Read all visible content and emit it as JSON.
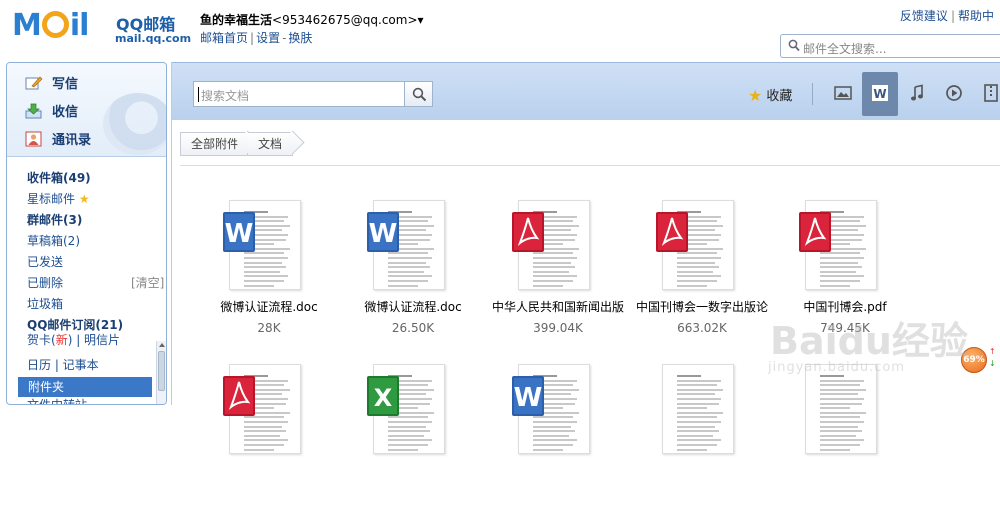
{
  "header": {
    "logo_main": "M",
    "logo_tail": "il",
    "logo_cn": "QQ邮箱",
    "logo_url": "mail.qq.com",
    "user_name": "鱼的幸福生活",
    "user_email": "<953462675@qq.com>",
    "links": [
      "邮箱首页",
      "设置",
      "换肤"
    ],
    "top_links": [
      "反馈建议",
      "帮助中"
    ],
    "fulltext_search_placeholder": "邮件全文搜索..."
  },
  "nav": {
    "quick": [
      {
        "label": "写信",
        "icon": "write-icon"
      },
      {
        "label": "收信",
        "icon": "receive-icon"
      },
      {
        "label": "通讯录",
        "icon": "contacts-icon"
      }
    ],
    "folders": [
      {
        "label": "收件箱(49)",
        "bold": true
      },
      {
        "label": "星标邮件",
        "star": true
      },
      {
        "label": "群邮件(3)",
        "bold": true
      },
      {
        "label": "草稿箱(2)"
      },
      {
        "label": "已发送"
      },
      {
        "label": "已删除",
        "right": "[清空]"
      },
      {
        "label": "垃圾箱"
      },
      {
        "label": "QQ邮件订阅(21)",
        "bold": true
      },
      {
        "label": "贺卡(新) | 明信片"
      },
      {
        "label": "日历 | 记事本"
      },
      {
        "label": "附件夹",
        "selected": true
      },
      {
        "label": "文件中转站"
      }
    ]
  },
  "toolbar": {
    "doc_search_placeholder": "搜索文档",
    "favorites_label": "收藏",
    "views": [
      "image-view-icon",
      "word-view-icon",
      "music-view-icon",
      "video-view-icon",
      "archive-view-icon"
    ],
    "active_view": "word-view-icon"
  },
  "breadcrumb": [
    "全部附件",
    "文档"
  ],
  "files": [
    {
      "name": "微博认证流程.doc",
      "size": "28K",
      "type": "word"
    },
    {
      "name": "微博认证流程.doc",
      "size": "26.50K",
      "type": "word"
    },
    {
      "name": "中华人民共和国新闻出版",
      "size": "399.04K",
      "type": "pdf"
    },
    {
      "name": "中国刊博会一数字出版论",
      "size": "663.02K",
      "type": "pdf"
    },
    {
      "name": "中国刊博会.pdf",
      "size": "749.45K",
      "type": "pdf"
    }
  ],
  "files_row2": [
    {
      "type": "pdf"
    },
    {
      "type": "excel"
    },
    {
      "type": "word"
    },
    {
      "type": "plain"
    },
    {
      "type": "plain"
    }
  ],
  "widget": {
    "percent": "69%"
  },
  "watermark": {
    "line1": "Baidu经验",
    "line2": "jingyan.baidu.com"
  },
  "colors": {
    "accent": "#3b78c7",
    "toolbar": "#c6daf2",
    "link": "#1d4f91"
  }
}
